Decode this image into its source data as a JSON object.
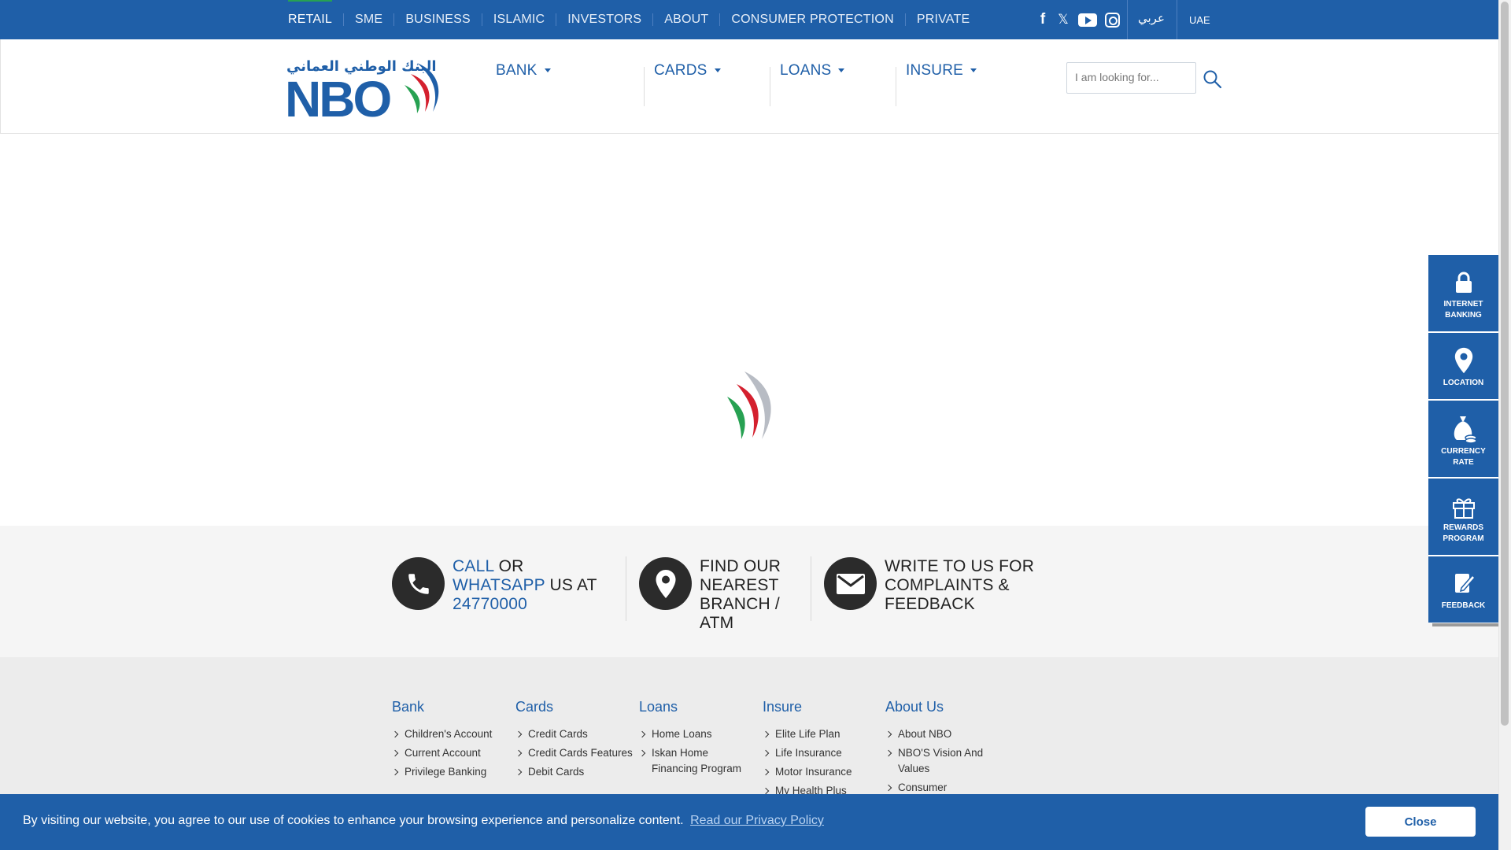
{
  "topnav": {
    "items": [
      {
        "label": "RETAIL"
      },
      {
        "label": "SME"
      },
      {
        "label": "BUSINESS"
      },
      {
        "label": "ISLAMIC"
      },
      {
        "label": "INVESTORS"
      },
      {
        "label": "ABOUT"
      },
      {
        "label": "CONSUMER PROTECTION"
      },
      {
        "label": "PRIVATE"
      }
    ],
    "social": [
      "facebook-icon",
      "x-twitter-icon",
      "youtube-icon",
      "instagram-icon"
    ],
    "language": "عربي",
    "country": "UAE"
  },
  "header": {
    "logo_arabic": "البنك الوطني العماني",
    "logo_text": "NBO",
    "nav": [
      {
        "label": "BANK"
      },
      {
        "label": "CARDS"
      },
      {
        "label": "LOANS"
      },
      {
        "label": "INSURE"
      }
    ],
    "search_placeholder": "I am looking for..."
  },
  "contact": {
    "call": {
      "hl1": "CALL",
      "t1": " OR ",
      "hl2": "WHATSAPP",
      "t2": " US AT ",
      "hl3": "24770000"
    },
    "branch": {
      "text": "FIND OUR NEAREST BRANCH / ATM"
    },
    "write": {
      "text": "WRITE TO US FOR COMPLAINTS & FEEDBACK"
    }
  },
  "footer": {
    "columns": [
      {
        "title": "Bank",
        "links": [
          "Children's Account",
          "Current Account",
          "Privilege Banking"
        ]
      },
      {
        "title": "Cards",
        "links": [
          "Credit Cards",
          "Credit Cards Features",
          "Debit Cards"
        ]
      },
      {
        "title": "Loans",
        "links": [
          "Home Loans",
          "Iskan Home Financing Program"
        ]
      },
      {
        "title": "Insure",
        "links": [
          "Elite Life Plan",
          "Life Insurance",
          "Motor Insurance",
          "My Health Plus"
        ]
      },
      {
        "title": "About Us",
        "links": [
          "About NBO",
          "NBO'S Vision And Values",
          "Consumer"
        ]
      }
    ]
  },
  "quick": {
    "items": [
      {
        "label": "INTERNET BANKING",
        "icon": "lock-icon"
      },
      {
        "label": "LOCATION",
        "icon": "location-pin-icon"
      },
      {
        "label": "CURRENCY RATE",
        "icon": "money-bag-icon"
      },
      {
        "label": "REWARDS PROGRAM",
        "icon": "gift-icon"
      },
      {
        "label": "FEEDBACK",
        "icon": "feedback-icon"
      }
    ]
  },
  "cookie": {
    "message": "By visiting our website, you agree to our use of cookies to enhance your browsing experience and personalize content.",
    "link": "Read our Privacy Policy",
    "close": "Close"
  },
  "colors": {
    "brand_blue": "#1f5fa8",
    "green": "#27a152",
    "red": "#d4202e",
    "dark": "#2b2b2b"
  }
}
